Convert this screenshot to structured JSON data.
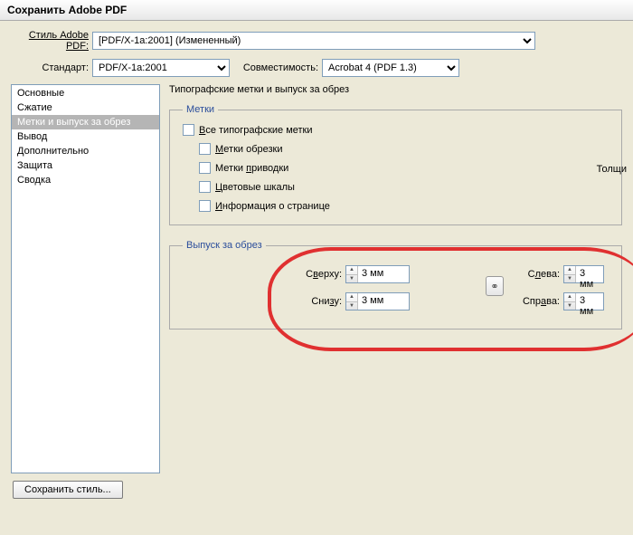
{
  "window_title": "Сохранить Adobe PDF",
  "style_label": "Стиль Adobe PDF:",
  "style_value": "[PDF/X-1a:2001] (Измененный)",
  "standard_label": "Стандарт:",
  "standard_value": "PDF/X-1a:2001",
  "compat_label": "Совместимость:",
  "compat_value": "Acrobat 4 (PDF 1.3)",
  "sidebar": {
    "items": [
      "Основные",
      "Сжатие",
      "Метки и выпуск за обрез",
      "Вывод",
      "Дополнительно",
      "Защита",
      "Сводка"
    ],
    "active_index": 2
  },
  "panel_title": "Типографские метки и выпуск за обрез",
  "marks": {
    "legend": "Метки",
    "all": "Все типографские метки",
    "trim": "Метки обрезки",
    "reg": "Метки приводки",
    "color": "Цветовые шкалы",
    "page": "Информация о странице",
    "thickness_partial": "Толщи"
  },
  "bleed": {
    "legend": "Выпуск за обрез",
    "top_label": "Сверху:",
    "bottom_label": "Снизу:",
    "left_label": "Слева:",
    "right_label": "Справа:",
    "top_value": "3 мм",
    "bottom_value": "3 мм",
    "left_value": "3 мм",
    "right_value": "3 мм"
  },
  "save_style_btn": "Сохранить стиль..."
}
